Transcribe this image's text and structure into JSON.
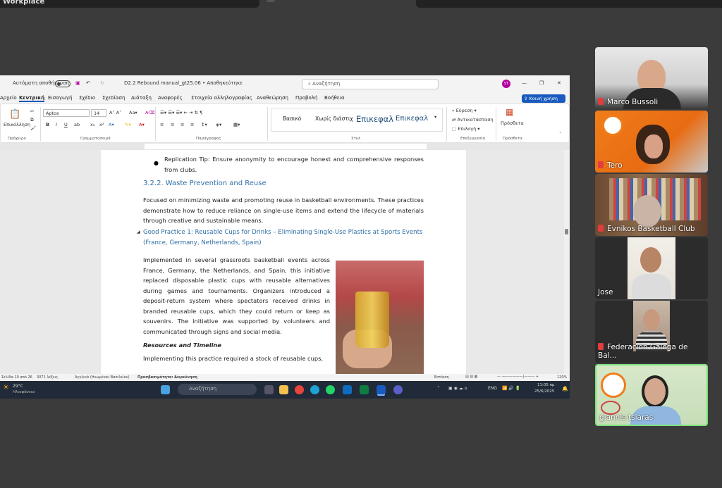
{
  "meeting": {
    "window_title_top": "Workplace"
  },
  "word": {
    "autosave_label": "Αυτόματη αποθήκευση",
    "doc_title": "D2.2 Rebound manual_gt25.06 • Αποθηκεύτηκε",
    "search_placeholder": "Αναζήτηση",
    "avatar_initials": "ST",
    "share_label": "Κοινή χρήση",
    "menu": [
      "Αρχείο",
      "Κεντρική",
      "Εισαγωγή",
      "Σχέδιο",
      "Σχεδίαση",
      "Διάταξη",
      "Αναφορές",
      "Στοιχεία αλληλογραφίας",
      "Αναθεώρηση",
      "Προβολή",
      "Βοήθεια"
    ],
    "active_menu": "Κεντρική",
    "ribbon": {
      "paste_label": "Επικόλληση",
      "font_name": "Aptos",
      "font_size": "14",
      "styles": [
        "Βασικό",
        "Χωρίς διάστιχ",
        "Επικεφαλ",
        "Επικεφαλ"
      ],
      "find_label": "Εύρεση",
      "replace_label": "Αντικατάσταση",
      "select_label": "Επιλογή",
      "addins_label": "Πρόσθετα",
      "group_clipboard": "Πρόχειρο",
      "group_font": "Γραμματοσειρά",
      "group_paragraph": "Παράγραφος",
      "group_styles": "Στυλ",
      "group_editing": "Επεξεργασία",
      "group_addins": "Πρόσθετα"
    },
    "document": {
      "bullet_text": "Replication Tip: Ensure anonymity to encourage honest and comprehensive responses from clubs.",
      "heading": "3.2.2. Waste Prevention and Reuse",
      "para1": "Focused on minimizing waste and promoting reuse in basketball environments. These practices demonstrate how to reduce reliance on single-use items and extend the lifecycle of materials through creative and sustainable means.",
      "good_practice_heading": "Good Practice 1: Reusable Cups for Drinks – Eliminating Single-Use Plastics at Sports Events (France, Germany, Netherlands, Spain)",
      "para2": "Implemented in several grassroots basketball events across France, Germany, the Netherlands, and Spain, this initiative replaced disposable plastic cups with reusable alternatives during games and tournaments. Organizers introduced a deposit-return system where spectators received drinks in branded reusable cups, which they could return or keep as souvenirs. The initiative was supported by volunteers and communicated through signs and social media.",
      "subheading": "Resources and Timeline",
      "para3": "Implementing this practice required a stock of reusable cups,"
    },
    "status": {
      "page": "Σελίδα 10 από 26",
      "words": "3071 λέξεις",
      "language": "Αγγλικά (Ηνωμένου Βασιλείου)",
      "accessibility": "Προσβασιμότητα: Διερεύνηση",
      "focus": "Εστίαση",
      "zoom": "120%"
    }
  },
  "taskbar": {
    "temperature": "29°C",
    "weather": "Ηλιοφάνεια",
    "search": "Αναζήτηση",
    "lang": "ENG",
    "time": "11:05 πμ",
    "date": "25/6/2025"
  },
  "participants": [
    {
      "name": "Marco Bussoli",
      "muted": true
    },
    {
      "name": "Tero",
      "muted": true
    },
    {
      "name": "Evnikos Basketball Club",
      "muted": true
    },
    {
      "name": "Jose",
      "muted": false
    },
    {
      "name": "Federación Galega de Bal...",
      "muted": true
    },
    {
      "name": "giannis tsiaras",
      "muted": false
    }
  ],
  "colors": {
    "word_blue": "#185abd",
    "heading_blue": "#2f6ea5",
    "active_speaker": "#7de07d"
  }
}
